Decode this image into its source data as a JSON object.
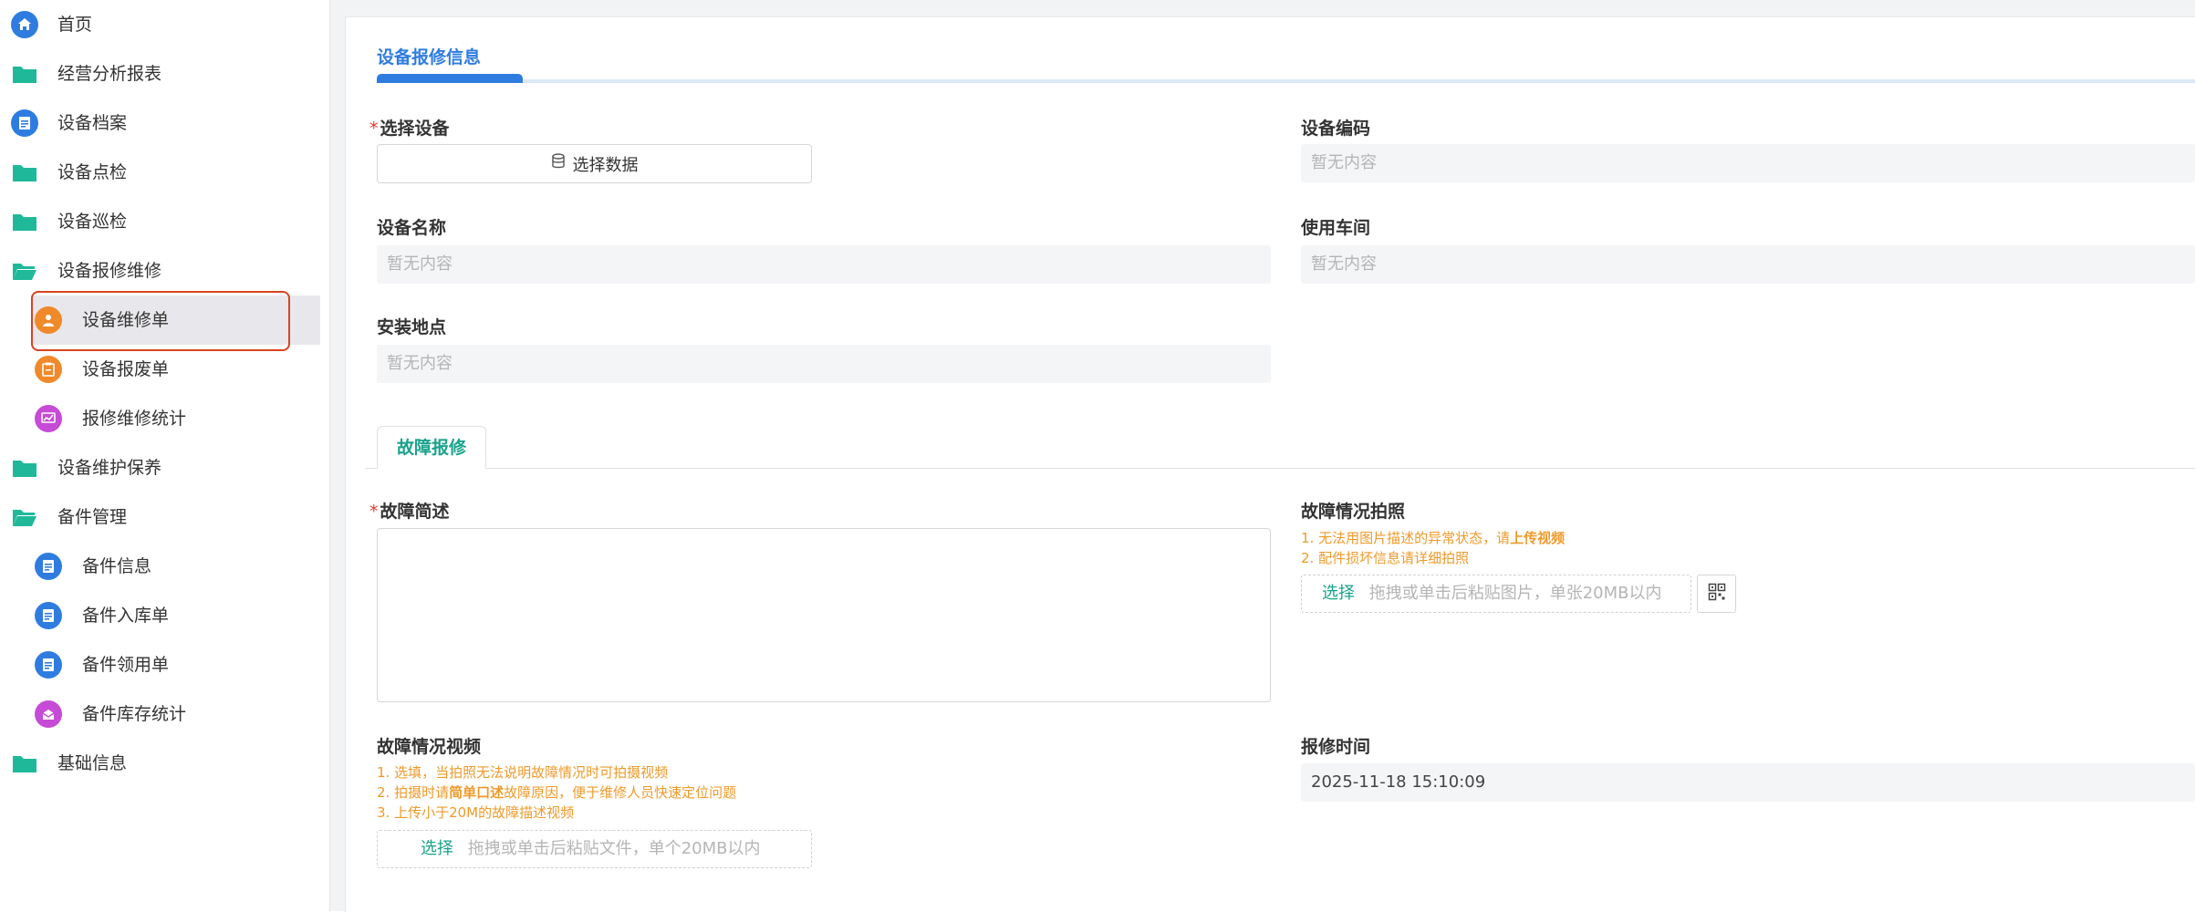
{
  "sidebar": {
    "items": [
      {
        "label": "首页"
      },
      {
        "label": "经营分析报表"
      },
      {
        "label": "设备档案"
      },
      {
        "label": "设备点检"
      },
      {
        "label": "设备巡检"
      },
      {
        "label": "设备报修维修"
      },
      {
        "label": "设备维修单"
      },
      {
        "label": "设备报废单"
      },
      {
        "label": "报修维修统计"
      },
      {
        "label": "设备维护保养"
      },
      {
        "label": "备件管理"
      },
      {
        "label": "备件信息"
      },
      {
        "label": "备件入库单"
      },
      {
        "label": "备件领用单"
      },
      {
        "label": "备件库存统计"
      },
      {
        "label": "基础信息"
      }
    ],
    "active": "设备维修单"
  },
  "form": {
    "section_title": "设备报修信息",
    "select_device_label": "选择设备",
    "select_data_button": "选择数据",
    "device_code_label": "设备编码",
    "device_code_value": "暂无内容",
    "device_name_label": "设备名称",
    "device_name_value": "暂无内容",
    "workshop_label": "使用车间",
    "workshop_value": "暂无内容",
    "location_label": "安装地点",
    "location_value": "暂无内容",
    "tab_label": "故障报修",
    "fault_desc_label": "故障简述",
    "photo_label": "故障情况拍照",
    "photo_hint_1_pre": "1. 无法用图片描述的异常状态，请",
    "photo_hint_1_bold": "上传视频",
    "photo_hint_2": "2. 配件损坏信息请详细拍照",
    "photo_pick": "选择",
    "photo_placeholder": "拖拽或单击后粘贴图片，单张20MB以内",
    "video_label": "故障情况视频",
    "video_hint_1": "1. 选填，当拍照无法说明故障情况时可拍摄视频",
    "video_hint_2_pre": "2. 拍摄时请",
    "video_hint_2_bold": "简单口述",
    "video_hint_2_post": "故障原因，便于维修人员快速定位问题",
    "video_hint_3": "3. 上传小于20M的故障描述视频",
    "video_pick": "选择",
    "video_placeholder": "拖拽或单击后粘贴文件，单个20MB以内",
    "report_time_label": "报修时间",
    "report_time_value": "2025-11-18 15:10:09"
  },
  "colors": {
    "accent": "#2f7ce0",
    "teal": "#19a38b",
    "orange": "#f0892a",
    "purple": "#c64bd6",
    "folder": "#1fb99a",
    "required": "#e5372c",
    "hint": "#ef9a2a",
    "active_outline": "#d9431f"
  }
}
